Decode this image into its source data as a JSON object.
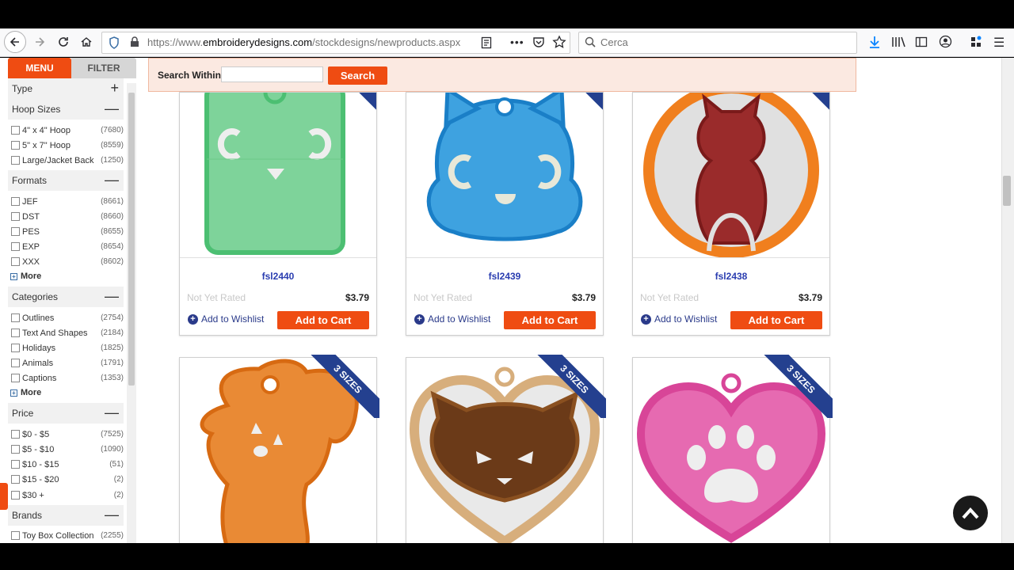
{
  "browser": {
    "url_prefix": "https://www.",
    "url_domain": "embroiderydesigns.com",
    "url_path": "/stockdesigns/newproducts.aspx",
    "search_placeholder": "Cerca"
  },
  "sidebar": {
    "tab_menu": "MENU",
    "tab_filter": "FILTER",
    "sections": [
      {
        "title": "Type",
        "sign": "+",
        "options": []
      },
      {
        "title": "Hoop Sizes",
        "sign": "—",
        "options": [
          {
            "label": "4\" x 4\" Hoop",
            "count": "(7680)"
          },
          {
            "label": "5\" x 7\" Hoop",
            "count": "(8559)"
          },
          {
            "label": "Large/Jacket Back",
            "count": "(1250)"
          }
        ]
      },
      {
        "title": "Formats",
        "sign": "—",
        "options": [
          {
            "label": "JEF",
            "count": "(8661)"
          },
          {
            "label": "DST",
            "count": "(8660)"
          },
          {
            "label": "PES",
            "count": "(8655)"
          },
          {
            "label": "EXP",
            "count": "(8654)"
          },
          {
            "label": "XXX",
            "count": "(8602)"
          }
        ],
        "more": "More"
      },
      {
        "title": "Categories",
        "sign": "—",
        "options": [
          {
            "label": "Outlines",
            "count": "(2754)"
          },
          {
            "label": "Text And Shapes",
            "count": "(2184)"
          },
          {
            "label": "Holidays",
            "count": "(1825)"
          },
          {
            "label": "Animals",
            "count": "(1791)"
          },
          {
            "label": "Captions",
            "count": "(1353)"
          }
        ],
        "more": "More"
      },
      {
        "title": "Price",
        "sign": "—",
        "options": [
          {
            "label": "$0 - $5",
            "count": "(7525)"
          },
          {
            "label": "$5 - $10",
            "count": "(1090)"
          },
          {
            "label": "$10 - $15",
            "count": "(51)"
          },
          {
            "label": "$15 - $20",
            "count": "(2)"
          },
          {
            "label": "$30 +",
            "count": "(2)"
          }
        ]
      },
      {
        "title": "Brands",
        "sign": "—",
        "options": [
          {
            "label": "Toy Box Collection",
            "count": "(2255)"
          }
        ]
      }
    ]
  },
  "search_within": {
    "label": "Search Within:",
    "value": "",
    "button": "Search"
  },
  "products": [
    {
      "sku": "fsl2440",
      "rating": "Not Yet Rated",
      "price": "$3.79",
      "wishlist": "Add to Wishlist",
      "cart": "Add to Cart"
    },
    {
      "sku": "fsl2439",
      "rating": "Not Yet Rated",
      "price": "$3.79",
      "wishlist": "Add to Wishlist",
      "cart": "Add to Cart"
    },
    {
      "sku": "fsl2438",
      "rating": "Not Yet Rated",
      "price": "$3.79",
      "wishlist": "Add to Wishlist",
      "cart": "Add to Cart"
    }
  ],
  "ribbon_text": "3 SIZES",
  "colors": {
    "accent": "#ef4c12",
    "ribbon": "#24408f",
    "link": "#2a3db0"
  }
}
